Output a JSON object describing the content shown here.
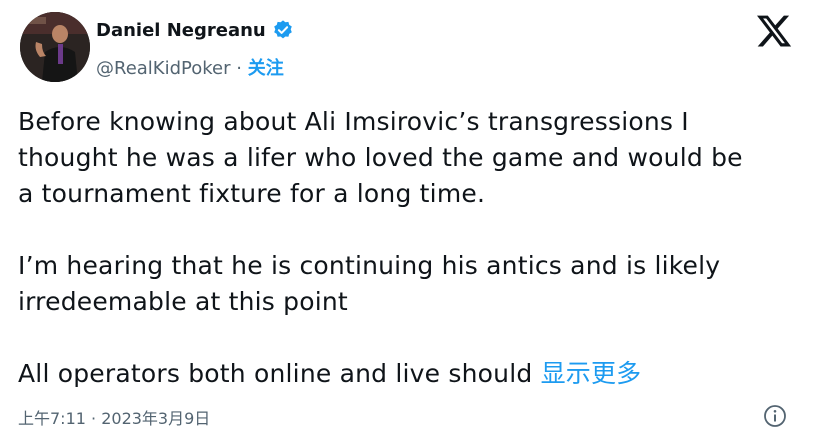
{
  "author": {
    "name": "Daniel Negreanu",
    "handle": "@RealKidPoker",
    "separator": " · ",
    "follow_label": "关注",
    "verified_color": "#1d9bf0"
  },
  "icons": {
    "platform": "x-logo-icon",
    "verified": "verified-badge-icon",
    "info": "info-icon"
  },
  "tweet": {
    "line1": "Before knowing about Ali Imsirovic’s transgressions I",
    "line2": "thought he was a lifer who loved the game and would be",
    "line3": "a tournament fixture for a long time.",
    "line4": "I’m hearing that he is continuing his antics and is likely",
    "line5": "irredeemable at this point",
    "line6": "All operators both online and live should ",
    "show_more": "显示更多"
  },
  "meta": {
    "time": "上午7:11",
    "separator": " · ",
    "date": "2023年3月9日"
  }
}
